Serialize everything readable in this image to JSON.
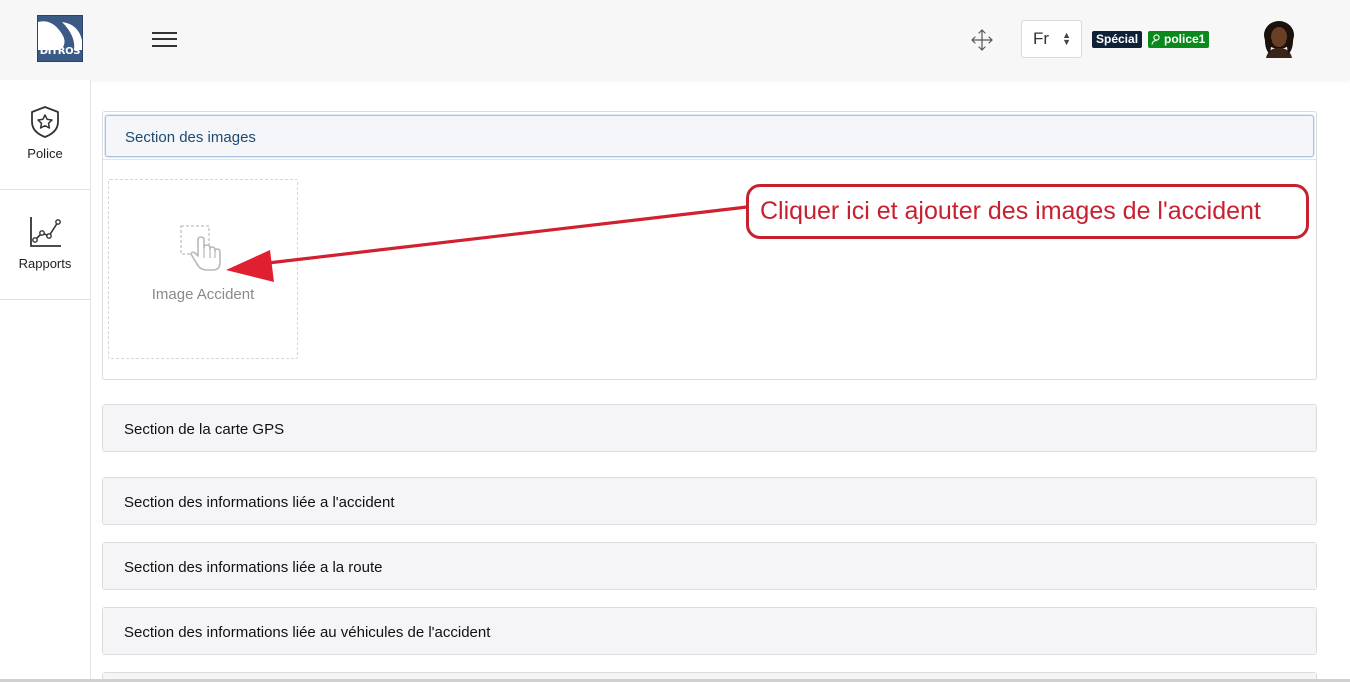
{
  "header": {
    "logo_text": "DITROS",
    "menu_icon": "hamburger-menu-icon",
    "move_icon": "move-arrows-icon",
    "language": {
      "selected": "Fr"
    },
    "badges": {
      "special": "Spécial",
      "user": "police1"
    },
    "avatar_icon": "user-avatar"
  },
  "sidebar": {
    "items": [
      {
        "label": "Police",
        "icon": "police-shield-icon"
      },
      {
        "label": "Rapports",
        "icon": "line-chart-icon"
      }
    ]
  },
  "sections": [
    {
      "title": "Section des images",
      "expanded": true
    },
    {
      "title": "Section de la carte GPS",
      "expanded": false
    },
    {
      "title": "Section des informations liée a l'accident",
      "expanded": false
    },
    {
      "title": "Section des informations liée a la route",
      "expanded": false
    },
    {
      "title": "Section des informations liée au véhicules de l'accident",
      "expanded": false
    }
  ],
  "image_upload": {
    "caption": "Image Accident",
    "icon": "hand-click-icon"
  },
  "annotation": {
    "text": "Cliquer ici et ajouter des images de l'accident",
    "color": "#c7202f"
  },
  "colors": {
    "header_bg": "#f7f7f7",
    "badge_special": "#0f2136",
    "badge_user": "#0a8a1a",
    "accent": "#c7202f"
  }
}
